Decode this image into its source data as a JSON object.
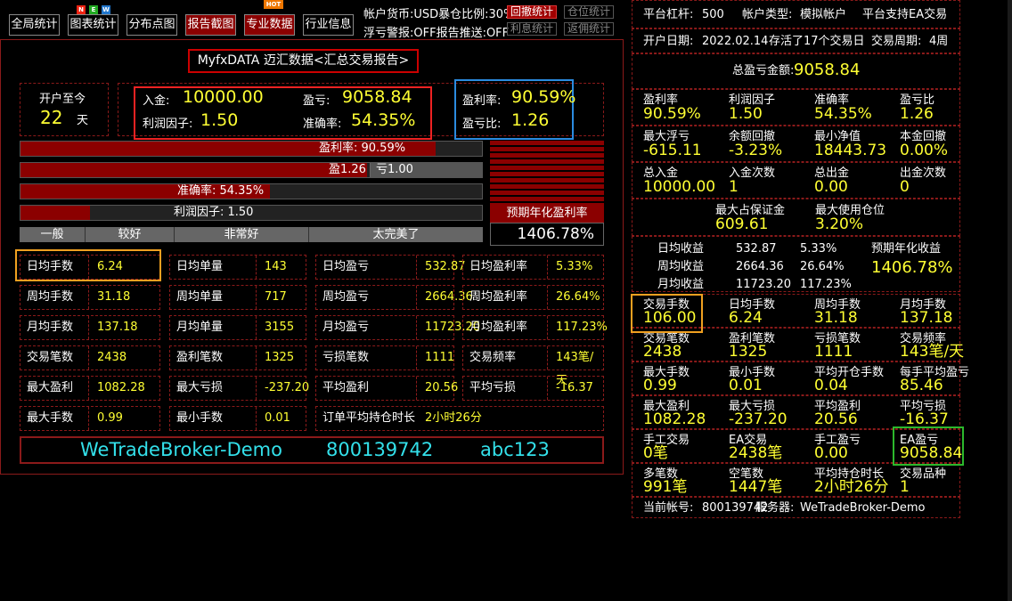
{
  "toolbar": {
    "btn_global": "全局统计",
    "btn_chart": "图表统计",
    "btn_scatter": "分布点图",
    "btn_report": "报告截图",
    "btn_pro": "专业数据",
    "btn_industry": "行业信息",
    "new_n": "N",
    "new_e": "E",
    "new_w": "W",
    "hot": "HOT",
    "currency": "帐户货币:USD暴仓比例:30%",
    "warn": "浮亏警报:OFF报告推送:OFF",
    "btn_rollback": "回撤统计",
    "btn_position": "仓位统计",
    "btn_interest": "利息统计",
    "btn_rebate": "返佣统计"
  },
  "title": "MyfxDATA 迈汇数据<汇总交易报告>",
  "open": {
    "label": "开户至今",
    "days": "22",
    "unit": "天"
  },
  "summary": {
    "deposit_label": "入金:",
    "deposit": "10000.00",
    "pl_label": "盈亏:",
    "pl": "9058.84",
    "pf_label": "利润因子:",
    "pf": "1.50",
    "acc_label": "准确率:",
    "acc": "54.35%"
  },
  "ratio": {
    "win_label": "盈利率:",
    "win": "90.59%",
    "plr_label": "盈亏比:",
    "plr": "1.26"
  },
  "bars": {
    "b1": {
      "text": "盈利率: 90.59%",
      "fill": 0.9
    },
    "b2": {
      "text_win": "盈1.26",
      "text_loss": "亏1.00",
      "fill": 0.75
    },
    "b3": {
      "text": "准确率: 54.35%",
      "fill": 0.54
    },
    "b4": {
      "text": "利润因子: 1.50",
      "fill": 0.15
    }
  },
  "scale": [
    "一般",
    "较好",
    "非常好",
    "太完美了"
  ],
  "forecast": {
    "label": "预期年化盈利率",
    "value": "1406.78%"
  },
  "grid": [
    [
      {
        "l": "日均手数",
        "v": "6.24"
      },
      {
        "l": "日均单量",
        "v": "143"
      },
      {
        "l": "日均盈亏",
        "v": "532.87"
      },
      {
        "l": "日均盈利率",
        "v": "5.33%"
      }
    ],
    [
      {
        "l": "周均手数",
        "v": "31.18"
      },
      {
        "l": "周均单量",
        "v": "717"
      },
      {
        "l": "周均盈亏",
        "v": "2664.36"
      },
      {
        "l": "周均盈利率",
        "v": "26.64%"
      }
    ],
    [
      {
        "l": "月均手数",
        "v": "137.18"
      },
      {
        "l": "月均单量",
        "v": "3155"
      },
      {
        "l": "月均盈亏",
        "v": "11723.20"
      },
      {
        "l": "月均盈利率",
        "v": "117.23%"
      }
    ],
    [
      {
        "l": "交易笔数",
        "v": "2438"
      },
      {
        "l": "盈利笔数",
        "v": "1325"
      },
      {
        "l": "亏损笔数",
        "v": "1111"
      },
      {
        "l": "交易频率",
        "v": "143笔/天"
      }
    ],
    [
      {
        "l": "最大盈利",
        "v": "1082.28"
      },
      {
        "l": "最大亏损",
        "v": "-237.20"
      },
      {
        "l": "平均盈利",
        "v": "20.56"
      },
      {
        "l": "平均亏损",
        "v": "-16.37"
      }
    ],
    [
      {
        "l": "最大手数",
        "v": "0.99"
      },
      {
        "l": "最小手数",
        "v": "0.01"
      },
      {
        "l": "订单平均持仓时长",
        "v": "2小时26分"
      }
    ]
  ],
  "footer": {
    "server": "WeTradeBroker-Demo",
    "account": "800139742",
    "password": "abc123"
  },
  "right": {
    "leverage_label": "平台杠杆:",
    "leverage": "500",
    "acct_type_label": "帐户类型:",
    "acct_type": "模拟帐户",
    "ea_support": "平台支持EA交易",
    "open_date_label": "开户日期:",
    "open_date": "2022.02.14",
    "alive": "存活了17个交易日",
    "period_label": "交易周期:",
    "period": "4周",
    "total_pl_label": "总盈亏金额:",
    "total_pl": "9058.84",
    "rows": [
      [
        {
          "l": "盈利率",
          "v": "90.59%"
        },
        {
          "l": "利润因子",
          "v": "1.50"
        },
        {
          "l": "准确率",
          "v": "54.35%"
        },
        {
          "l": "盈亏比",
          "v": "1.26"
        }
      ],
      [
        {
          "l": "最大浮亏",
          "v": "-615.11"
        },
        {
          "l": "余额回撤",
          "v": "-3.23%"
        },
        {
          "l": "最小净值",
          "v": "18443.73"
        },
        {
          "l": "本金回撤",
          "v": "0.00%"
        }
      ],
      [
        {
          "l": "总入金",
          "v": "10000.00"
        },
        {
          "l": "入金次数",
          "v": "1"
        },
        {
          "l": "总出金",
          "v": "0.00"
        },
        {
          "l": "出金次数",
          "v": "0"
        }
      ]
    ],
    "margin_label": "最大占保证金",
    "margin": "609.61",
    "max_pos_label": "最大使用仓位",
    "max_pos": "3.20%",
    "avg": [
      {
        "l": "日均收益",
        "a": "532.87",
        "p": "5.33%"
      },
      {
        "l": "周均收益",
        "a": "2664.36",
        "p": "26.64%"
      },
      {
        "l": "月均收益",
        "a": "11723.20",
        "p": "117.23%"
      }
    ],
    "annual_label": "预期年化收益",
    "annual": "1406.78%",
    "rows2": [
      [
        {
          "l": "交易手数",
          "v": "106.00"
        },
        {
          "l": "日均手数",
          "v": "6.24"
        },
        {
          "l": "周均手数",
          "v": "31.18"
        },
        {
          "l": "月均手数",
          "v": "137.18"
        }
      ],
      [
        {
          "l": "交易笔数",
          "v": "2438"
        },
        {
          "l": "盈利笔数",
          "v": "1325"
        },
        {
          "l": "亏损笔数",
          "v": "1111"
        },
        {
          "l": "交易频率",
          "v": "143笔/天"
        }
      ],
      [
        {
          "l": "最大手数",
          "v": "0.99"
        },
        {
          "l": "最小手数",
          "v": "0.01"
        },
        {
          "l": "平均开仓手数",
          "v": "0.04"
        },
        {
          "l": "每手平均盈亏",
          "v": "85.46"
        }
      ],
      [
        {
          "l": "最大盈利",
          "v": "1082.28"
        },
        {
          "l": "最大亏损",
          "v": "-237.20"
        },
        {
          "l": "平均盈利",
          "v": "20.56"
        },
        {
          "l": "平均亏损",
          "v": "-16.37"
        }
      ],
      [
        {
          "l": "手工交易",
          "v": "0笔"
        },
        {
          "l": "EA交易",
          "v": "2438笔"
        },
        {
          "l": "手工盈亏",
          "v": "0.00"
        },
        {
          "l": "EA盈亏",
          "v": "9058.84"
        }
      ],
      [
        {
          "l": "多笔数",
          "v": "991笔"
        },
        {
          "l": "空笔数",
          "v": "1447笔"
        },
        {
          "l": "平均持仓时长",
          "v": "2小时26分"
        },
        {
          "l": "交易品种",
          "v": "1"
        }
      ]
    ],
    "cur_acct_label": "当前帐号:",
    "cur_acct": "800139742",
    "server_label": "服务器:",
    "server": "WeTradeBroker-Demo"
  }
}
